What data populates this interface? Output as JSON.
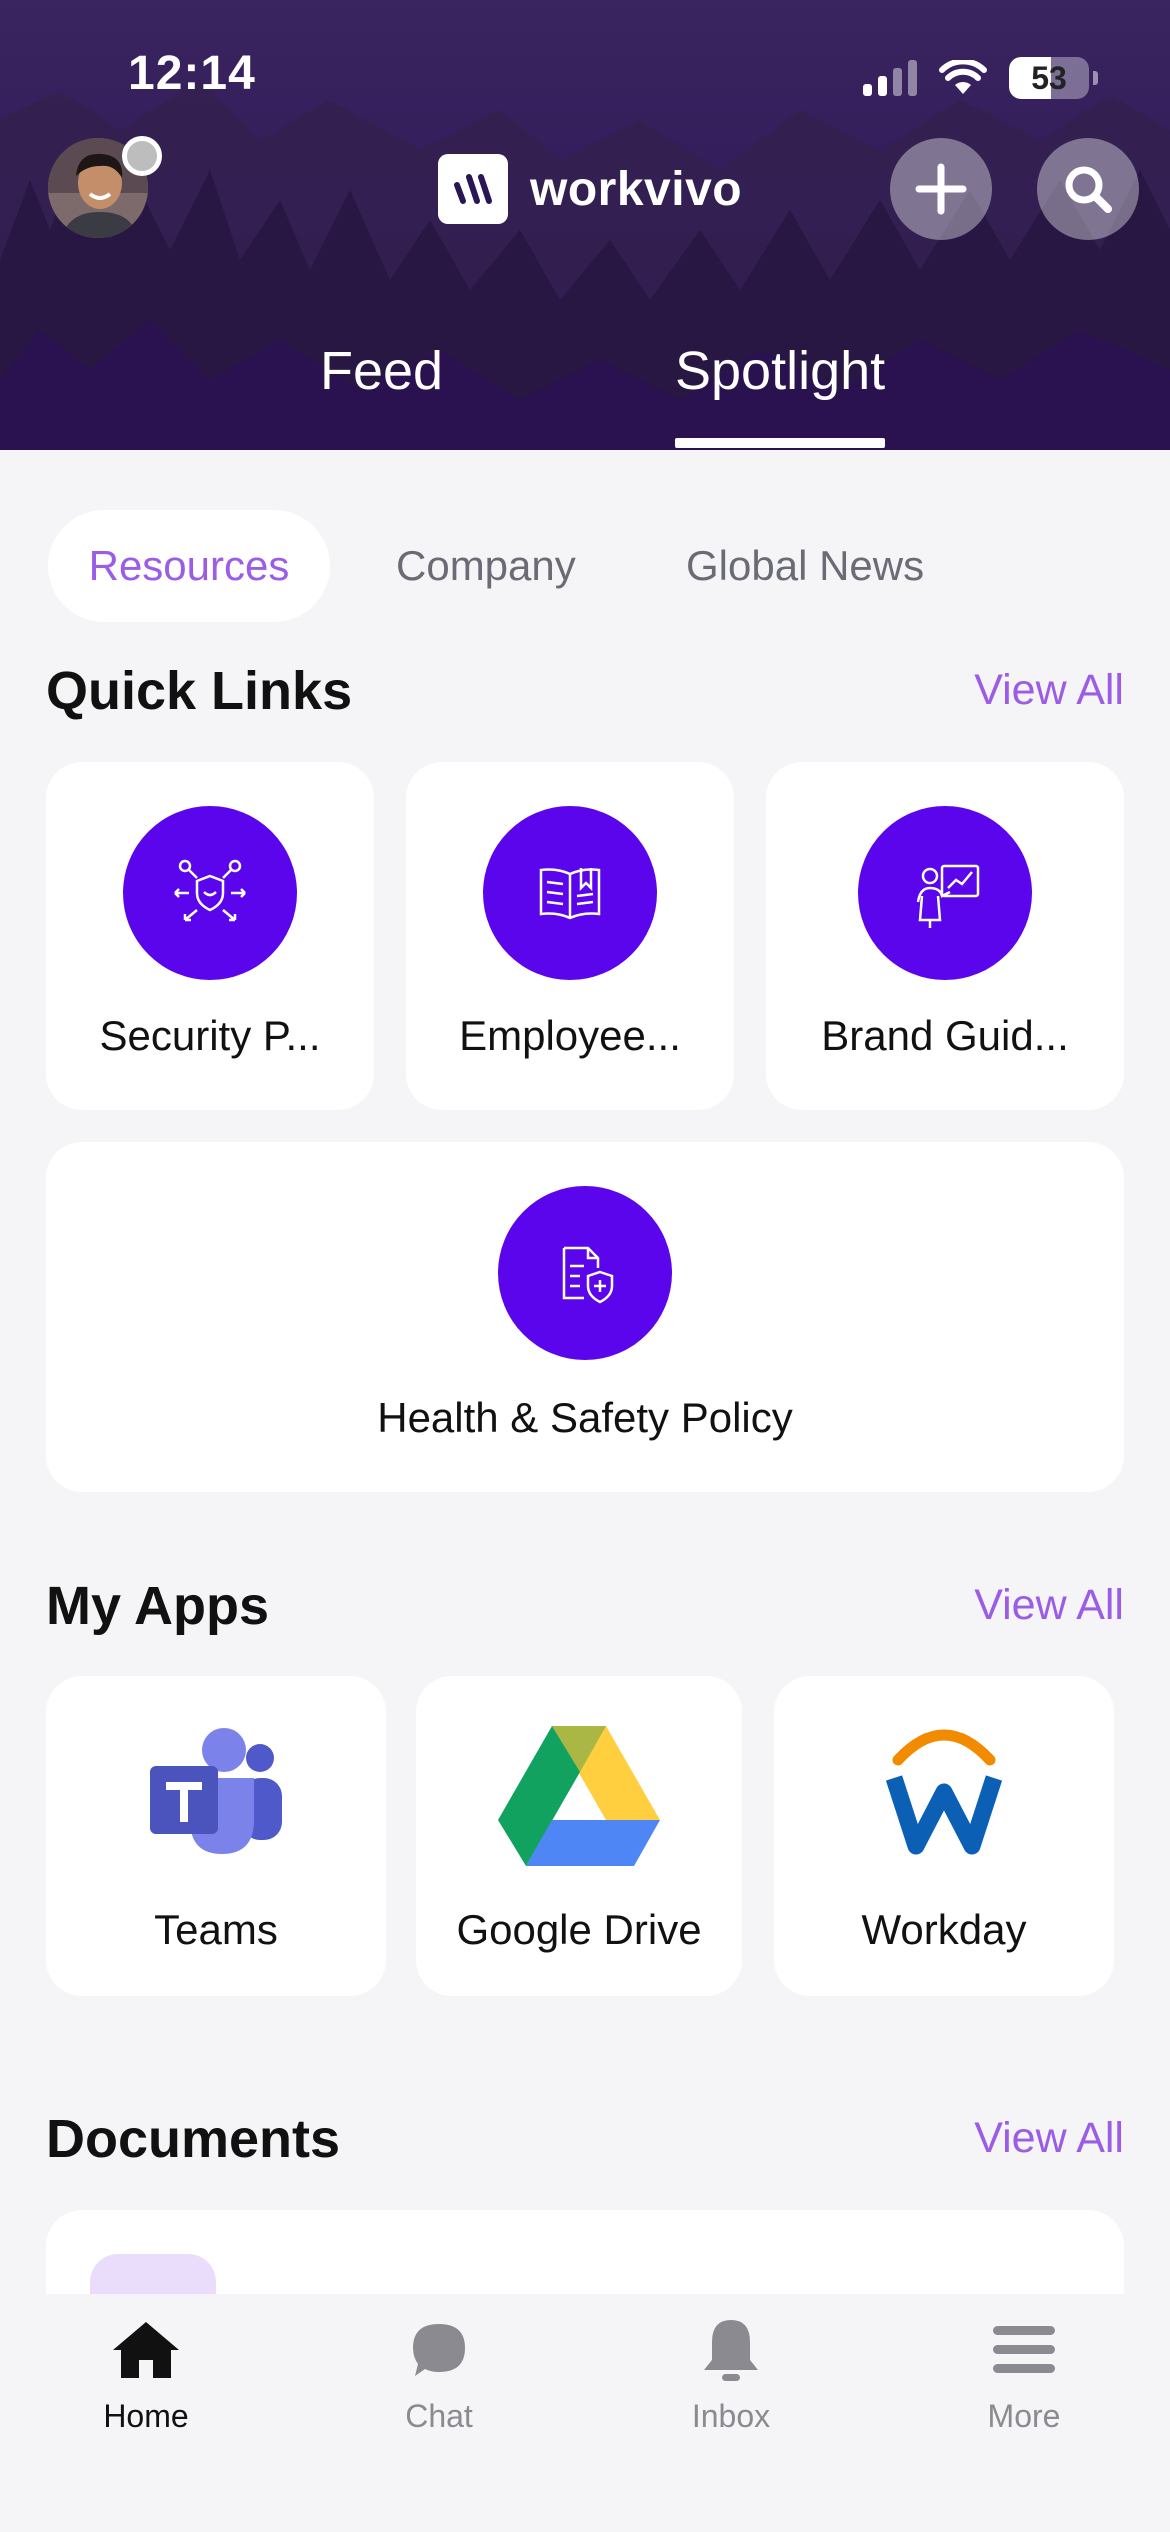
{
  "status_bar": {
    "time": "12:14",
    "battery": "53",
    "battery_level": 0.53
  },
  "header": {
    "brand_name": "workvivo",
    "main_tabs": [
      {
        "label": "Feed",
        "active": false
      },
      {
        "label": "Spotlight",
        "active": true
      }
    ]
  },
  "sub_tabs": [
    {
      "label": "Resources",
      "active": true
    },
    {
      "label": "Company",
      "active": false
    },
    {
      "label": "Global News",
      "active": false
    }
  ],
  "quick_links": {
    "title": "Quick Links",
    "view_all": "View All",
    "items": [
      {
        "label": "Security P...",
        "icon": "security-network-icon"
      },
      {
        "label": "Employee...",
        "icon": "open-book-icon"
      },
      {
        "label": "Brand Guid...",
        "icon": "presentation-icon"
      },
      {
        "label": "Health & Safety Policy",
        "icon": "document-shield-icon"
      }
    ]
  },
  "my_apps": {
    "title": "My Apps",
    "view_all": "View All",
    "items": [
      {
        "label": "Teams",
        "icon": "teams-icon"
      },
      {
        "label": "Google Drive",
        "icon": "google-drive-icon"
      },
      {
        "label": "Workday",
        "icon": "workday-icon"
      }
    ]
  },
  "documents": {
    "title": "Documents",
    "view_all": "View All"
  },
  "bottom_nav": [
    {
      "label": "Home",
      "icon": "home-icon",
      "active": true
    },
    {
      "label": "Chat",
      "icon": "chat-bubble-icon",
      "active": false
    },
    {
      "label": "Inbox",
      "icon": "bell-icon",
      "active": false
    },
    {
      "label": "More",
      "icon": "hamburger-menu-icon",
      "active": false
    }
  ],
  "colors": {
    "accent": "#9b5de5",
    "quick_link_circle": "#5a05ec",
    "header_bg": "#2b1655",
    "page_bg": "#f5f5f7"
  }
}
